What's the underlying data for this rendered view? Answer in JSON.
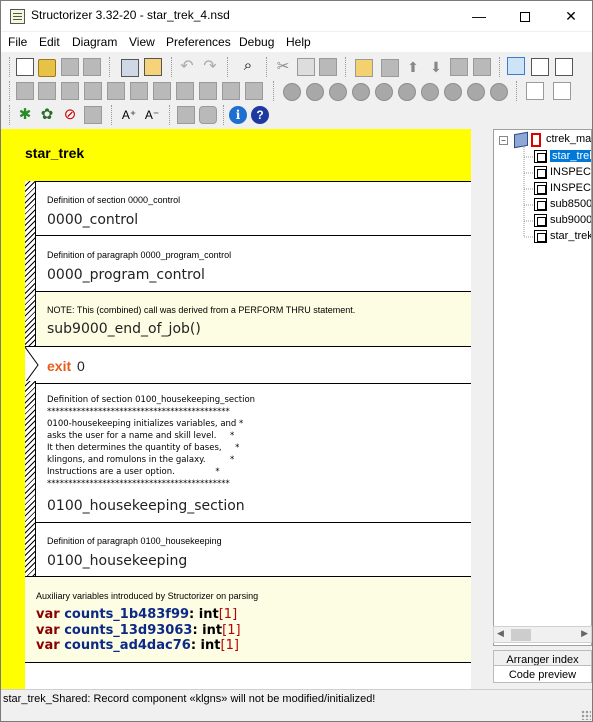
{
  "window": {
    "title": "Structorizer 3.32-20 - star_trek_4.nsd",
    "min_glyph": "—",
    "close_glyph": "✕"
  },
  "menu": [
    "File",
    "Edit",
    "Diagram",
    "View",
    "Preferences",
    "Debug",
    "Help"
  ],
  "toolbar": {
    "info_glyph": "i",
    "help_glyph": "?",
    "font_up": "A⁺",
    "font_down": "A⁻",
    "binoculars": "⌕",
    "scissors": "✂"
  },
  "diagram": {
    "title": "star_trek",
    "blocks": [
      {
        "comment": "Definition of section 0000_control",
        "code": "0000_control"
      },
      {
        "comment": "Definition of paragraph 0000_program_control",
        "code": "0000_program_control"
      },
      {
        "comment": "NOTE: This (combined) call was derived from a PERFORM THRU statement.",
        "code": "sub9000_end_of_job()"
      }
    ],
    "exit": {
      "keyword": "exit",
      "value": "0"
    },
    "housekeeping_section": {
      "comment_lines": "Definition of section 0100_housekeeping_section\n*******************************************\n0100-housekeeping initializes variables, and *\nasks the user for a name and skill level.     *\nIt then determines the quantity of bases,     *\nklingons, and romulons in the galaxy.         *\nInstructions are a user option.               *\n*******************************************",
      "code": "0100_housekeeping_section"
    },
    "housekeeping_para": {
      "comment": "Definition of paragraph 0100_housekeeping",
      "code": "0100_housekeeping"
    },
    "aux": {
      "comment": "Auxiliary variables introduced by Structorizer on parsing",
      "vars": [
        {
          "kw": "var",
          "name": "counts_1b483f99",
          "type": "int",
          "size": "1"
        },
        {
          "kw": "var",
          "name": "counts_13d93063",
          "type": "int",
          "size": "1"
        },
        {
          "kw": "var",
          "name": "counts_ad4dac76",
          "type": "int",
          "size": "1"
        }
      ]
    }
  },
  "tree": {
    "root": "ctrek_main",
    "items": [
      "star_trek",
      "INSPECT",
      "INSPECT",
      "sub8500",
      "sub9000",
      "star_trek"
    ]
  },
  "tabs": {
    "arranger": "Arranger index",
    "preview": "Code preview"
  },
  "status": "star_trek_Shared: Record component «klgns» will not be modified/initialized!",
  "colors": {
    "accent_yellow": "#ffff00",
    "cream": "#fdfde4",
    "exit_orange": "#e85c18",
    "selection_blue": "#0078d7"
  }
}
